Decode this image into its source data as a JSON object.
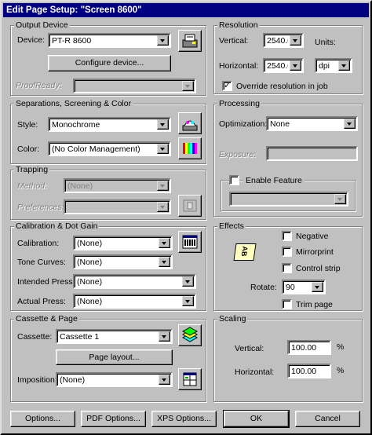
{
  "window": {
    "title": "Edit Page Setup: \"Screen 8600\""
  },
  "output_device": {
    "title": "Output Device",
    "device_label": "Device:",
    "device_value": "PT-R 8600",
    "configure_button": "Configure device...",
    "proofready_label": "ProofReady:",
    "proofready_value": ""
  },
  "separations": {
    "title": "Separations, Screening & Color",
    "style_label": "Style:",
    "style_value": "Monochrome",
    "color_label": "Color:",
    "color_value": "(No Color Management)"
  },
  "trapping": {
    "title": "Trapping",
    "method_label": "Method:",
    "method_value": "(None)",
    "preferences_label": "Preferences:",
    "preferences_value": ""
  },
  "calibration": {
    "title": "Calibration & Dot Gain",
    "calibration_label": "Calibration:",
    "calibration_value": "(None)",
    "tone_curves_label": "Tone Curves:",
    "tone_curves_value": "(None)",
    "intended_press_label": "Intended Press:",
    "intended_press_value": "(None)",
    "actual_press_label": "Actual Press:",
    "actual_press_value": "(None)"
  },
  "cassette": {
    "title": "Cassette & Page",
    "cassette_label": "Cassette:",
    "cassette_value": "Cassette 1",
    "page_layout_button": "Page layout...",
    "imposition_label": "Imposition:",
    "imposition_value": "(None)"
  },
  "resolution": {
    "title": "Resolution",
    "vertical_label": "Vertical:",
    "vertical_value": "2540.0",
    "units_label": "Units:",
    "horizontal_label": "Horizontal:",
    "horizontal_value": "2540.0",
    "units_value": "dpi",
    "override_label": "Override resolution in job",
    "override_checked": true
  },
  "processing": {
    "title": "Processing",
    "optimization_label": "Optimization:",
    "optimization_value": "None",
    "exposure_label": "Exposure:",
    "exposure_value": "",
    "enable_feature_label": "Enable Feature",
    "feature_value": ""
  },
  "effects": {
    "title": "Effects",
    "negative_label": "Negative",
    "mirrorprint_label": "Mirrorprint",
    "control_strip_label": "Control strip",
    "rotate_label": "Rotate:",
    "rotate_value": "90",
    "trim_page_label": "Trim page",
    "preview_text": "AB"
  },
  "scaling": {
    "title": "Scaling",
    "vertical_label": "Vertical:",
    "vertical_value": "100.00",
    "horizontal_label": "Horizontal:",
    "horizontal_value": "100.00",
    "percent": "%"
  },
  "footer": {
    "options": "Options...",
    "pdf_options": "PDF Options...",
    "xps_options": "XPS Options...",
    "ok": "OK",
    "cancel": "Cancel"
  }
}
